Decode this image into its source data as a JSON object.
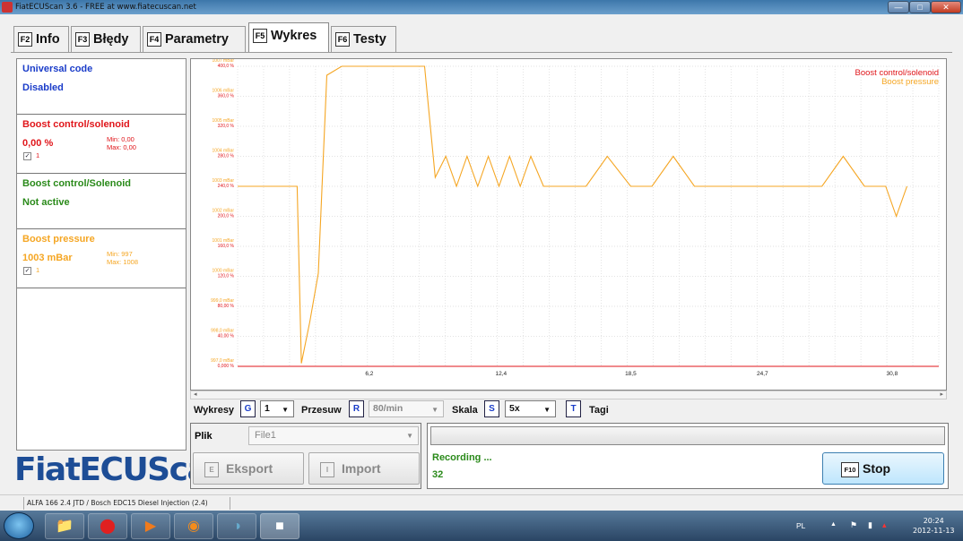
{
  "window": {
    "title": "FiatECUScan 3.6 - FREE at www.fiatecuscan.net"
  },
  "tabs": [
    {
      "key": "F2",
      "label": "Info"
    },
    {
      "key": "F3",
      "label": "Błędy"
    },
    {
      "key": "F4",
      "label": "Parametry"
    },
    {
      "key": "F5",
      "label": "Wykres",
      "active": true
    },
    {
      "key": "F6",
      "label": "Testy"
    }
  ],
  "params": [
    {
      "name": "Universal code",
      "value": "Disabled",
      "color": "#1a3cc9"
    },
    {
      "name": "Boost control/solenoid",
      "value": "0,00 %",
      "min": "Min: 0,00",
      "max": "Max: 0,00",
      "checkbox": "1",
      "color": "#e0161b"
    },
    {
      "name": "Boost control/Solenoid",
      "value": "Not active",
      "color": "#2a8a1a"
    },
    {
      "name": "Boost pressure",
      "value": "1003 mBar",
      "min": "Min: 997",
      "max": "Max: 1008",
      "checkbox": "1",
      "color": "#f5a623"
    }
  ],
  "logo": "FiatECUScan",
  "chart_data": {
    "type": "line",
    "x_ticks": [
      "6,2",
      "12,4",
      "18,5",
      "24,7",
      "30,8"
    ],
    "xlim": [
      0,
      33
    ],
    "y_ticks_left_mbar": [
      "997,0 mBar",
      "998,0 mBar",
      "999,0 mBar",
      "1000 mBar",
      "1001 mBar",
      "1002 mBar",
      "1003 mBar",
      "1004 mBar",
      "1005 mBar",
      "1006 mBar",
      "1007 mBar"
    ],
    "y_ticks_left_pct": [
      "0,000 %",
      "40,00 %",
      "80,00 %",
      "120,0 %",
      "160,0 %",
      "200,0 %",
      "240,0 %",
      "280,0 %",
      "320,0 %",
      "360,0 %",
      "400,0 %"
    ],
    "ylim_mbar": [
      997,
      1007
    ],
    "ylim_pct": [
      0,
      400
    ],
    "series": [
      {
        "name": "Boost control/solenoid",
        "color": "#e0161b",
        "x": [
          0,
          33
        ],
        "y_pct": [
          0,
          0
        ]
      },
      {
        "name": "Boost pressure",
        "color": "#f5a623",
        "x": [
          0,
          2.8,
          3.0,
          3.4,
          3.8,
          4.2,
          4.9,
          5.7,
          6.5,
          7.2,
          8.8,
          9.3,
          9.8,
          10.3,
          10.8,
          11.3,
          11.8,
          12.3,
          12.8,
          13.3,
          13.8,
          14.4,
          15.4,
          16.4,
          17.4,
          18.5,
          19.5,
          20.5,
          21.5,
          22.5,
          23.5,
          24.5,
          25.5,
          26.5,
          27.5,
          28.5,
          29.5,
          30.5,
          31.0,
          31.5
        ],
        "y_mbar": [
          1003,
          1003,
          997.1,
          998.5,
          1000.1,
          1006.7,
          1007.0,
          1007.0,
          1007.0,
          1007.0,
          1007.0,
          1003.3,
          1004.0,
          1003.0,
          1004.0,
          1003.0,
          1004.0,
          1003.0,
          1004.0,
          1003.0,
          1004.0,
          1003.0,
          1003.0,
          1003.0,
          1004.0,
          1003.0,
          1003.0,
          1004.0,
          1003.0,
          1003.0,
          1003.0,
          1003.0,
          1003.0,
          1003.0,
          1003.0,
          1004.0,
          1003.0,
          1003.0,
          1002.0,
          1003.0
        ]
      }
    ],
    "legend": [
      "Boost control/solenoid",
      "Boost pressure"
    ],
    "legend_position": "top-right",
    "grid": true
  },
  "controls": {
    "wykresy_label": "Wykresy",
    "wykresy_key": "G",
    "wykresy_value": "1",
    "przesuw_label": "Przesuw",
    "przesuw_key": "R",
    "przesuw_value": "80/min",
    "skala_label": "Skala",
    "skala_key": "S",
    "skala_value": "5x",
    "tagi_key": "T",
    "tagi_label": "Tagi"
  },
  "file": {
    "label": "Plik",
    "value": "File1",
    "export_key": "E",
    "export_label": "Eksport",
    "import_key": "I",
    "import_label": "Import"
  },
  "status": {
    "recording": "Recording ...",
    "count": "32",
    "stop_key": "F10",
    "stop_label": "Stop"
  },
  "statusbar": {
    "vehicle": "ALFA 166 2.4 JTD / Bosch EDC15 Diesel Injection (2.4)"
  },
  "tray": {
    "lang": "PL",
    "time": "20:24",
    "date": "2012-11-13"
  }
}
